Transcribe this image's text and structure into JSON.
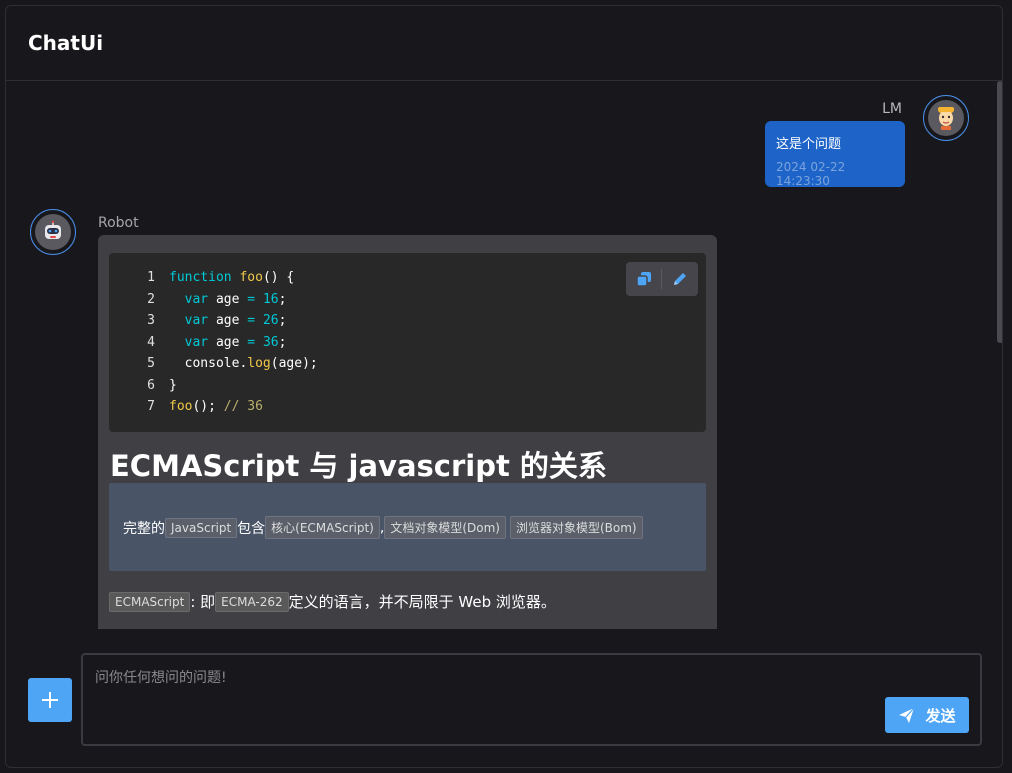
{
  "app": {
    "title": "ChatUi"
  },
  "messages": {
    "user": {
      "name": "LM",
      "text": "这是个问题",
      "time": "2024 02-22 14:23:30",
      "avatar_icon": "user-face-icon"
    },
    "robot": {
      "name": "Robot",
      "avatar_icon": "robot-face-icon",
      "code": {
        "line_numbers": [
          "1",
          "2",
          "3",
          "4",
          "5",
          "6",
          "7"
        ],
        "copy_icon": "copy-icon",
        "edit_icon": "pencil-icon"
      },
      "heading": "ECMAScript 与 javascript 的关系",
      "quote": {
        "prefix": "完整的",
        "tag1": "JavaScript",
        "mid": "包含",
        "tag2": "核心(ECMAScript)",
        "comma": ",",
        "tag3": "文档对象模型(Dom)",
        "tag4": "浏览器对象模型(Bom)"
      },
      "paragraph": {
        "tag1": "ECMAScript",
        "mid": ": 即",
        "tag2": "ECMA-262",
        "suffix": "定义的语言，并不局限于 Web 浏览器。"
      }
    }
  },
  "composer": {
    "placeholder": "问你任何想问的问题!",
    "value": "",
    "add_icon": "plus-icon",
    "send_label": "发送",
    "send_icon": "paper-plane-icon"
  },
  "colors": {
    "accent": "#4ea4f5",
    "user_bubble": "#1e64c8",
    "robot_bubble": "#3f3f44",
    "background": "#18181c"
  }
}
